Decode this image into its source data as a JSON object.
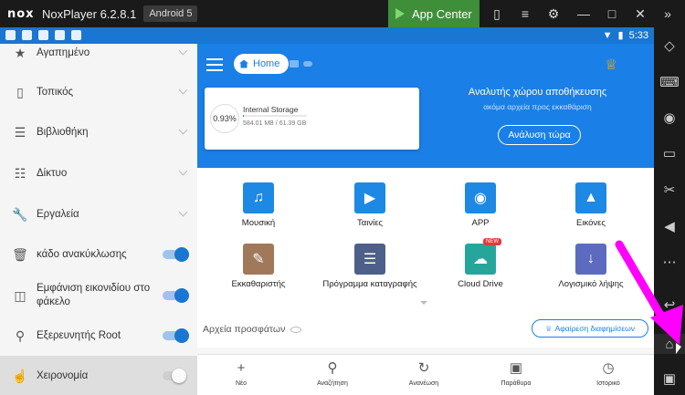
{
  "titlebar": {
    "logo": "nox",
    "title": "NoxPlayer 6.2.8.1",
    "android": "Android 5",
    "app_center": "App Center"
  },
  "statusbar": {
    "time": "5:33"
  },
  "drawer": {
    "items": [
      {
        "label": "Αγαπημένο",
        "icon": "star-icon",
        "control": "chevron"
      },
      {
        "label": "Τοπικός",
        "icon": "phone-icon",
        "control": "chevron"
      },
      {
        "label": "Βιβλιοθήκη",
        "icon": "library-icon",
        "control": "chevron"
      },
      {
        "label": "Δίκτυο",
        "icon": "network-icon",
        "control": "chevron"
      },
      {
        "label": "Εργαλεία",
        "icon": "wrench-icon",
        "control": "chevron"
      },
      {
        "label": "κάδο ανακύκλωσης",
        "icon": "trash-icon",
        "control": "toggle",
        "on": true
      },
      {
        "label": "Εμφάνιση εικονιδίου στο φάκελο",
        "icon": "folder-icon",
        "control": "toggle",
        "on": true
      },
      {
        "label": "Εξερευνητής Root",
        "icon": "root-icon",
        "control": "toggle",
        "on": true
      },
      {
        "label": "Χειρονομία",
        "icon": "gesture-icon",
        "control": "toggle",
        "on": false
      }
    ]
  },
  "main": {
    "breadcrumb": "Home",
    "storage": {
      "percent": "0.93%",
      "title": "Internal Storage",
      "size": "584.01 MB / 61.39 GB",
      "used_fraction": 0.0093
    },
    "promo": {
      "title": "Αναλυτής χώρου αποθήκευσης",
      "subtitle": "ακόμα αρχεία προς εκκαθάριση",
      "button": "Ανάλυση τώρα"
    },
    "grid": [
      {
        "label": "Μουσική",
        "icon": "music-icon",
        "color": "#1e88e5"
      },
      {
        "label": "Ταινίες",
        "icon": "video-icon",
        "color": "#1e88e5"
      },
      {
        "label": "APP",
        "icon": "android-icon",
        "color": "#1e88e5"
      },
      {
        "label": "Εικόνες",
        "icon": "image-icon",
        "color": "#1e88e5"
      },
      {
        "label": "Εκκαθαριστής",
        "icon": "broom-icon",
        "color": "#a0795a"
      },
      {
        "label": "Πρόγραμμα καταγραφής",
        "icon": "layers-icon",
        "color": "#4e5f8a"
      },
      {
        "label": "Cloud Drive",
        "icon": "cloud-icon",
        "color": "#26a69a",
        "badge": "NEW"
      },
      {
        "label": "Λογισμικό λήψης",
        "icon": "download-icon",
        "color": "#5c6bc0"
      }
    ],
    "recent_title": "Αρχεία προσφάτων",
    "ad_button": "Αφαίρεση διαφημίσεων"
  },
  "bottomnav": [
    {
      "label": "Νέο",
      "icon": "plus-icon"
    },
    {
      "label": "Αναζήτηση",
      "icon": "search-icon"
    },
    {
      "label": "Ανανέωση",
      "icon": "refresh-icon"
    },
    {
      "label": "Παράθυρα",
      "icon": "windows-icon"
    },
    {
      "label": "Ιστορικό",
      "icon": "history-icon"
    }
  ],
  "colors": {
    "accent": "#1a7fe6",
    "annotation_arrow": "#ff00ff",
    "appcenter": "#3e8e3a"
  }
}
